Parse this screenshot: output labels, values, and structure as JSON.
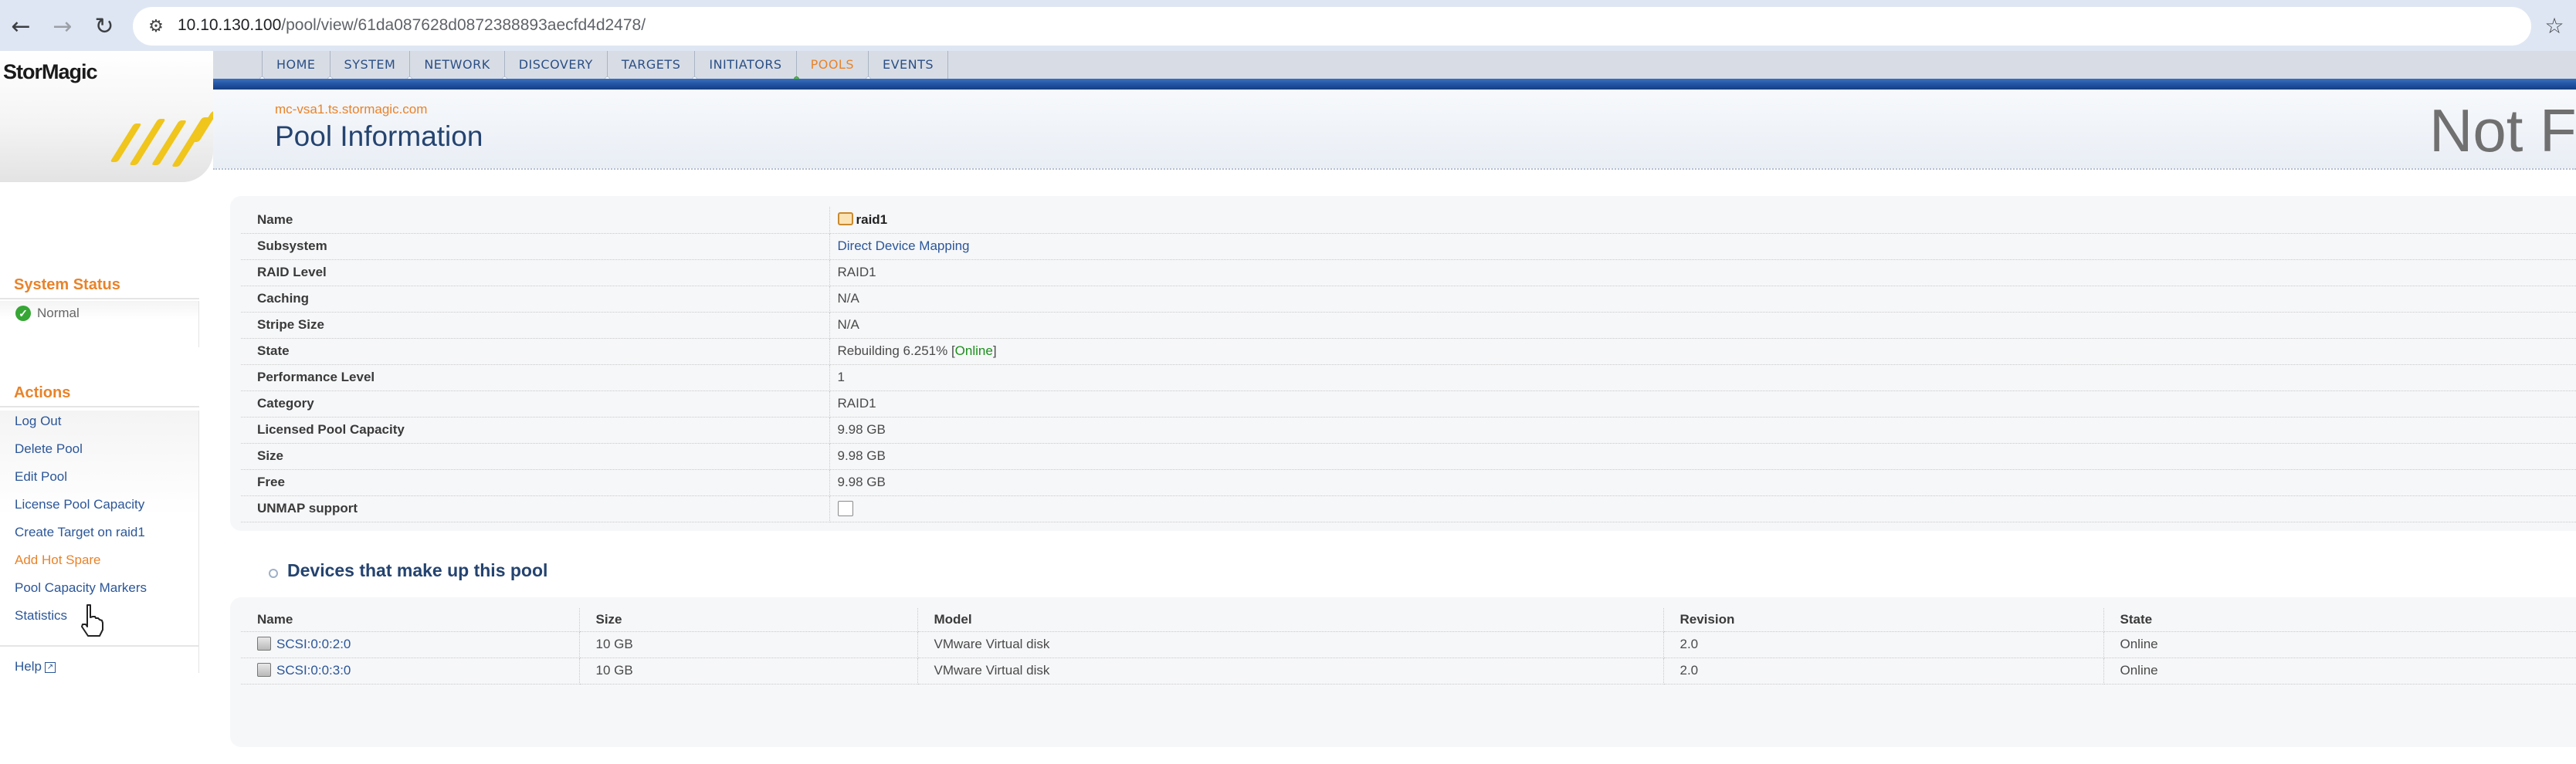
{
  "browser": {
    "url_host": "10.10.130.100",
    "url_path": "/pool/view/61da087628d0872388893aecfd4d2478/",
    "icons": [
      "back-arrow-icon",
      "forward-arrow-icon",
      "reload-icon",
      "site-info-icon",
      "bookmark-star-icon"
    ]
  },
  "brand": {
    "logo": "StorMagic"
  },
  "nav": {
    "items": [
      {
        "label": "HOME"
      },
      {
        "label": "SYSTEM"
      },
      {
        "label": "NETWORK"
      },
      {
        "label": "DISCOVERY"
      },
      {
        "label": "TARGETS"
      },
      {
        "label": "INITIATORS"
      },
      {
        "label": "POOLS"
      },
      {
        "label": "EVENTS"
      }
    ],
    "active": "POOLS",
    "active_color": "#e8832a",
    "bar_color": "#1f4f9f"
  },
  "header": {
    "host": "mc-vsa1.ts.stormagic.com",
    "title": "Pool Information",
    "overlay_text": "Not F"
  },
  "sidebar": {
    "status_heading": "System Status",
    "status_value": "Normal",
    "actions_heading": "Actions",
    "actions": [
      {
        "label": "Log Out"
      },
      {
        "label": "Delete Pool"
      },
      {
        "label": "Edit Pool"
      },
      {
        "label": "License Pool Capacity"
      },
      {
        "label": "Create Target on raid1"
      },
      {
        "label": "Add Hot Spare"
      },
      {
        "label": "Pool Capacity Markers"
      },
      {
        "label": "Statistics"
      }
    ],
    "help": "Help"
  },
  "pool": {
    "labels": {
      "name": "Name",
      "subsystem": "Subsystem",
      "raid_level": "RAID Level",
      "caching": "Caching",
      "stripe_size": "Stripe Size",
      "state": "State",
      "performance_level": "Performance Level",
      "category": "Category",
      "licensed_capacity": "Licensed Pool Capacity",
      "size": "Size",
      "free": "Free",
      "unmap": "UNMAP support"
    },
    "name": "raid1",
    "subsystem": "Direct Device Mapping",
    "raid_level": "RAID1",
    "caching": "N/A",
    "stripe_size": "N/A",
    "state_prefix": "Rebuilding 6.251% [",
    "state_online": "Online",
    "state_suffix": "]",
    "performance_level": "1",
    "category": "RAID1",
    "licensed_capacity": "9.98 GB",
    "size": "9.98 GB",
    "free": "9.98 GB",
    "unmap_checked": false
  },
  "devices": {
    "heading": "Devices that make up this pool",
    "columns": {
      "name": "Name",
      "size": "Size",
      "model": "Model",
      "revision": "Revision",
      "state": "State"
    },
    "rows": [
      {
        "name": "SCSI:0:0:2:0",
        "size": "10 GB",
        "model": "VMware Virtual disk",
        "revision": "2.0",
        "state": "Online"
      },
      {
        "name": "SCSI:0:0:3:0",
        "size": "10 GB",
        "model": "VMware Virtual disk",
        "revision": "2.0",
        "state": "Online"
      }
    ]
  }
}
